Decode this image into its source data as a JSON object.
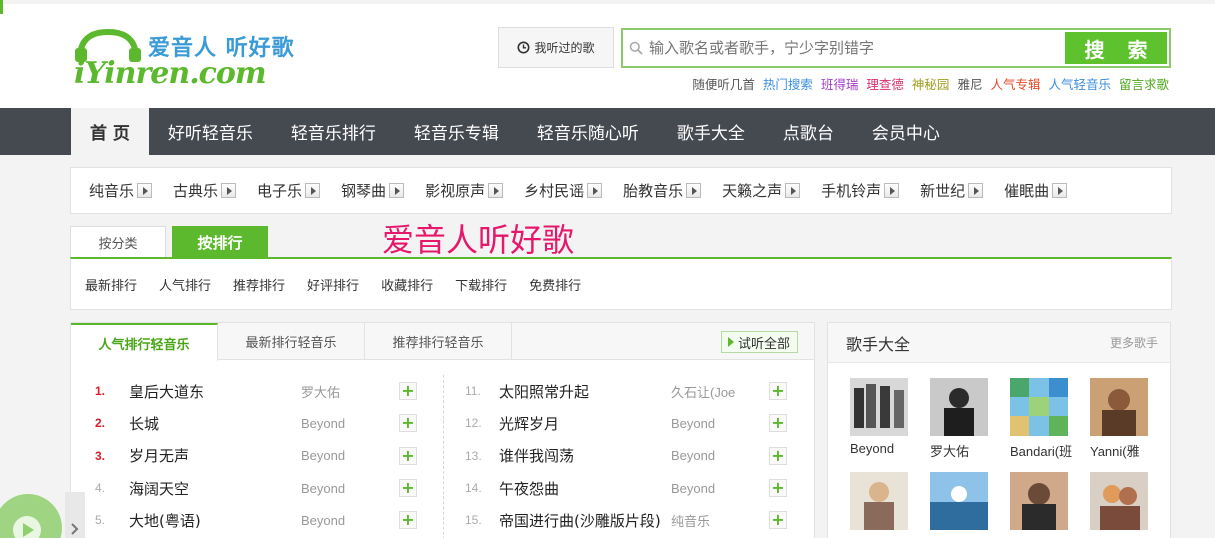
{
  "header": {
    "logo_tag": "爱音人 听好歌",
    "logo_word": "iYinren.com",
    "history_label": "我听过的歌",
    "search": {
      "placeholder": "输入歌名或者歌手，宁少字别错字",
      "button": "搜 索"
    },
    "quick_links": [
      {
        "label": "随便听几首",
        "color": "#555555"
      },
      {
        "label": "热门搜索",
        "color": "#3a8ee0"
      },
      {
        "label": "班得瑞",
        "color": "#a23cc8"
      },
      {
        "label": "理查德",
        "color": "#d8306c"
      },
      {
        "label": "神秘园",
        "color": "#a0a020"
      },
      {
        "label": "雅尼",
        "color": "#555555"
      },
      {
        "label": "人气专辑",
        "color": "#e6482a"
      },
      {
        "label": "人气轻音乐",
        "color": "#3a8ee0"
      },
      {
        "label": "留言求歌",
        "color": "#4aa618"
      }
    ]
  },
  "nav": [
    "首 页",
    "好听轻音乐",
    "轻音乐排行",
    "轻音乐专辑",
    "轻音乐随心听",
    "歌手大全",
    "点歌台",
    "会员中心"
  ],
  "genres": [
    "纯音乐",
    "古典乐",
    "电子乐",
    "钢琴曲",
    "影视原声",
    "乡村民谣",
    "胎教音乐",
    "天籁之声",
    "手机铃声",
    "新世纪",
    "催眠曲"
  ],
  "sort_tabs": [
    "按分类",
    "按排行"
  ],
  "slogan": "爱音人听好歌",
  "rank_links": [
    "最新排行",
    "人气排行",
    "推荐排行",
    "好评排行",
    "收藏排行",
    "下载排行",
    "免费排行"
  ],
  "chart_tabs": [
    "人气排行轻音乐",
    "最新排行轻音乐",
    "推荐排行轻音乐"
  ],
  "play_all": "试听全部",
  "songs_left": [
    {
      "num": "1.",
      "title": "皇后大道东",
      "artist": "罗大佑"
    },
    {
      "num": "2.",
      "title": "长城",
      "artist": "Beyond"
    },
    {
      "num": "3.",
      "title": "岁月无声",
      "artist": "Beyond"
    },
    {
      "num": "4.",
      "title": "海阔天空",
      "artist": "Beyond"
    },
    {
      "num": "5.",
      "title": "大地(粤语)",
      "artist": "Beyond"
    }
  ],
  "songs_right": [
    {
      "num": "11.",
      "title": "太阳照常升起",
      "artist": "久石让(Joe"
    },
    {
      "num": "12.",
      "title": "光辉岁月",
      "artist": "Beyond"
    },
    {
      "num": "13.",
      "title": "谁伴我闯荡",
      "artist": "Beyond"
    },
    {
      "num": "14.",
      "title": "午夜怨曲",
      "artist": "Beyond"
    },
    {
      "num": "15.",
      "title": "帝国进行曲(沙雕版片段)",
      "artist": "纯音乐"
    }
  ],
  "add_symbol": "+",
  "singers": {
    "title": "歌手大全",
    "more": "更多歌手",
    "artists": [
      "Beyond",
      "罗大佑",
      "Bandari(班",
      "Yanni(雅",
      "",
      "",
      "",
      ""
    ]
  }
}
